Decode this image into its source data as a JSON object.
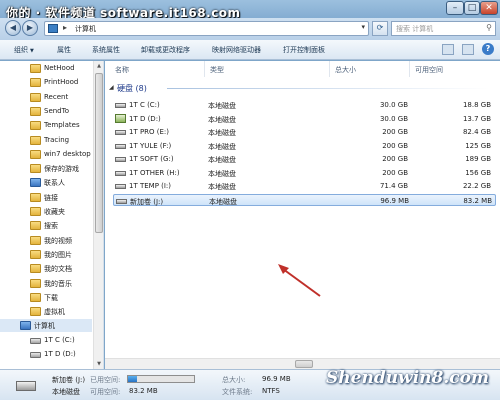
{
  "watermark_top": "你的 · 软件频道 software.it168.com",
  "address": {
    "path": "计算机",
    "search_placeholder": "搜索 计算机"
  },
  "toolbar": {
    "items": [
      "组织",
      "属性",
      "系统属性",
      "卸载或更改程序",
      "映射网络驱动器",
      "打开控制面板"
    ]
  },
  "sidebar": {
    "items": [
      {
        "label": "NetHood",
        "icon": "folder-icon",
        "indent": 2
      },
      {
        "label": "PrintHood",
        "icon": "folder-icon",
        "indent": 2
      },
      {
        "label": "Recent",
        "icon": "folder-icon",
        "indent": 2
      },
      {
        "label": "SendTo",
        "icon": "folder-icon",
        "indent": 2
      },
      {
        "label": "Templates",
        "icon": "folder-icon",
        "indent": 2
      },
      {
        "label": "Tracing",
        "icon": "folder-icon",
        "indent": 2
      },
      {
        "label": "win7 desktop",
        "icon": "folder-icon",
        "indent": 2
      },
      {
        "label": "保存的游戏",
        "icon": "folder-icon",
        "indent": 2
      },
      {
        "label": "联系人",
        "icon": "blue-folder-icon",
        "indent": 2
      },
      {
        "label": "链接",
        "icon": "folder-icon",
        "indent": 2
      },
      {
        "label": "收藏夹",
        "icon": "folder-icon",
        "indent": 2
      },
      {
        "label": "搜索",
        "icon": "folder-icon",
        "indent": 2
      },
      {
        "label": "我的视频",
        "icon": "folder-icon",
        "indent": 2
      },
      {
        "label": "我的图片",
        "icon": "folder-icon",
        "indent": 2
      },
      {
        "label": "我的文档",
        "icon": "folder-icon",
        "indent": 2
      },
      {
        "label": "我的音乐",
        "icon": "folder-icon",
        "indent": 2
      },
      {
        "label": "下载",
        "icon": "folder-icon",
        "indent": 2
      },
      {
        "label": "虚拟机",
        "icon": "folder-icon",
        "indent": 2
      },
      {
        "label": "计算机",
        "icon": "computer-icon",
        "indent": 1,
        "selected": true
      },
      {
        "label": "1T C (C:)",
        "icon": "drive-icon",
        "indent": 2
      },
      {
        "label": "1T D (D:)",
        "icon": "drive-icon",
        "indent": 2
      }
    ]
  },
  "columns": [
    "名称",
    "类型",
    "总大小",
    "可用空间"
  ],
  "group": "硬盘 (8)",
  "drives": [
    {
      "name": "1T C (C:)",
      "type": "本地磁盘",
      "total": "30.0 GB",
      "free": "18.8 GB",
      "system": false
    },
    {
      "name": "1T D (D:)",
      "type": "本地磁盘",
      "total": "30.0 GB",
      "free": "13.7 GB",
      "system": true
    },
    {
      "name": "1T PRO (E:)",
      "type": "本地磁盘",
      "total": "200 GB",
      "free": "82.4 GB",
      "system": false
    },
    {
      "name": "1T YULE (F:)",
      "type": "本地磁盘",
      "total": "200 GB",
      "free": "125 GB",
      "system": false
    },
    {
      "name": "1T SOFT (G:)",
      "type": "本地磁盘",
      "total": "200 GB",
      "free": "189 GB",
      "system": false
    },
    {
      "name": "1T OTHER (H:)",
      "type": "本地磁盘",
      "total": "200 GB",
      "free": "156 GB",
      "system": false
    },
    {
      "name": "1T TEMP (I:)",
      "type": "本地磁盘",
      "total": "71.4 GB",
      "free": "22.2 GB",
      "system": false
    },
    {
      "name": "新加卷 (J:)",
      "type": "本地磁盘",
      "total": "96.9 MB",
      "free": "83.2 MB",
      "system": false,
      "selected": true
    }
  ],
  "details": {
    "name": "新加卷 (J:)",
    "used_label": "已用空间:",
    "used_fraction": 0.14,
    "type": "本地磁盘",
    "free_label": "可用空间:",
    "free": "83.2 MB",
    "total_label": "总大小:",
    "total": "96.9 MB",
    "fs_label": "文件系统:",
    "fs": "NTFS"
  },
  "brand_watermark": "Shenduwin8.com",
  "colors": {
    "selection_bg": "#cfe4f9",
    "selection_border": "#84acdd",
    "group_text": "#1e3a8a",
    "arrow": "#c0302a"
  }
}
